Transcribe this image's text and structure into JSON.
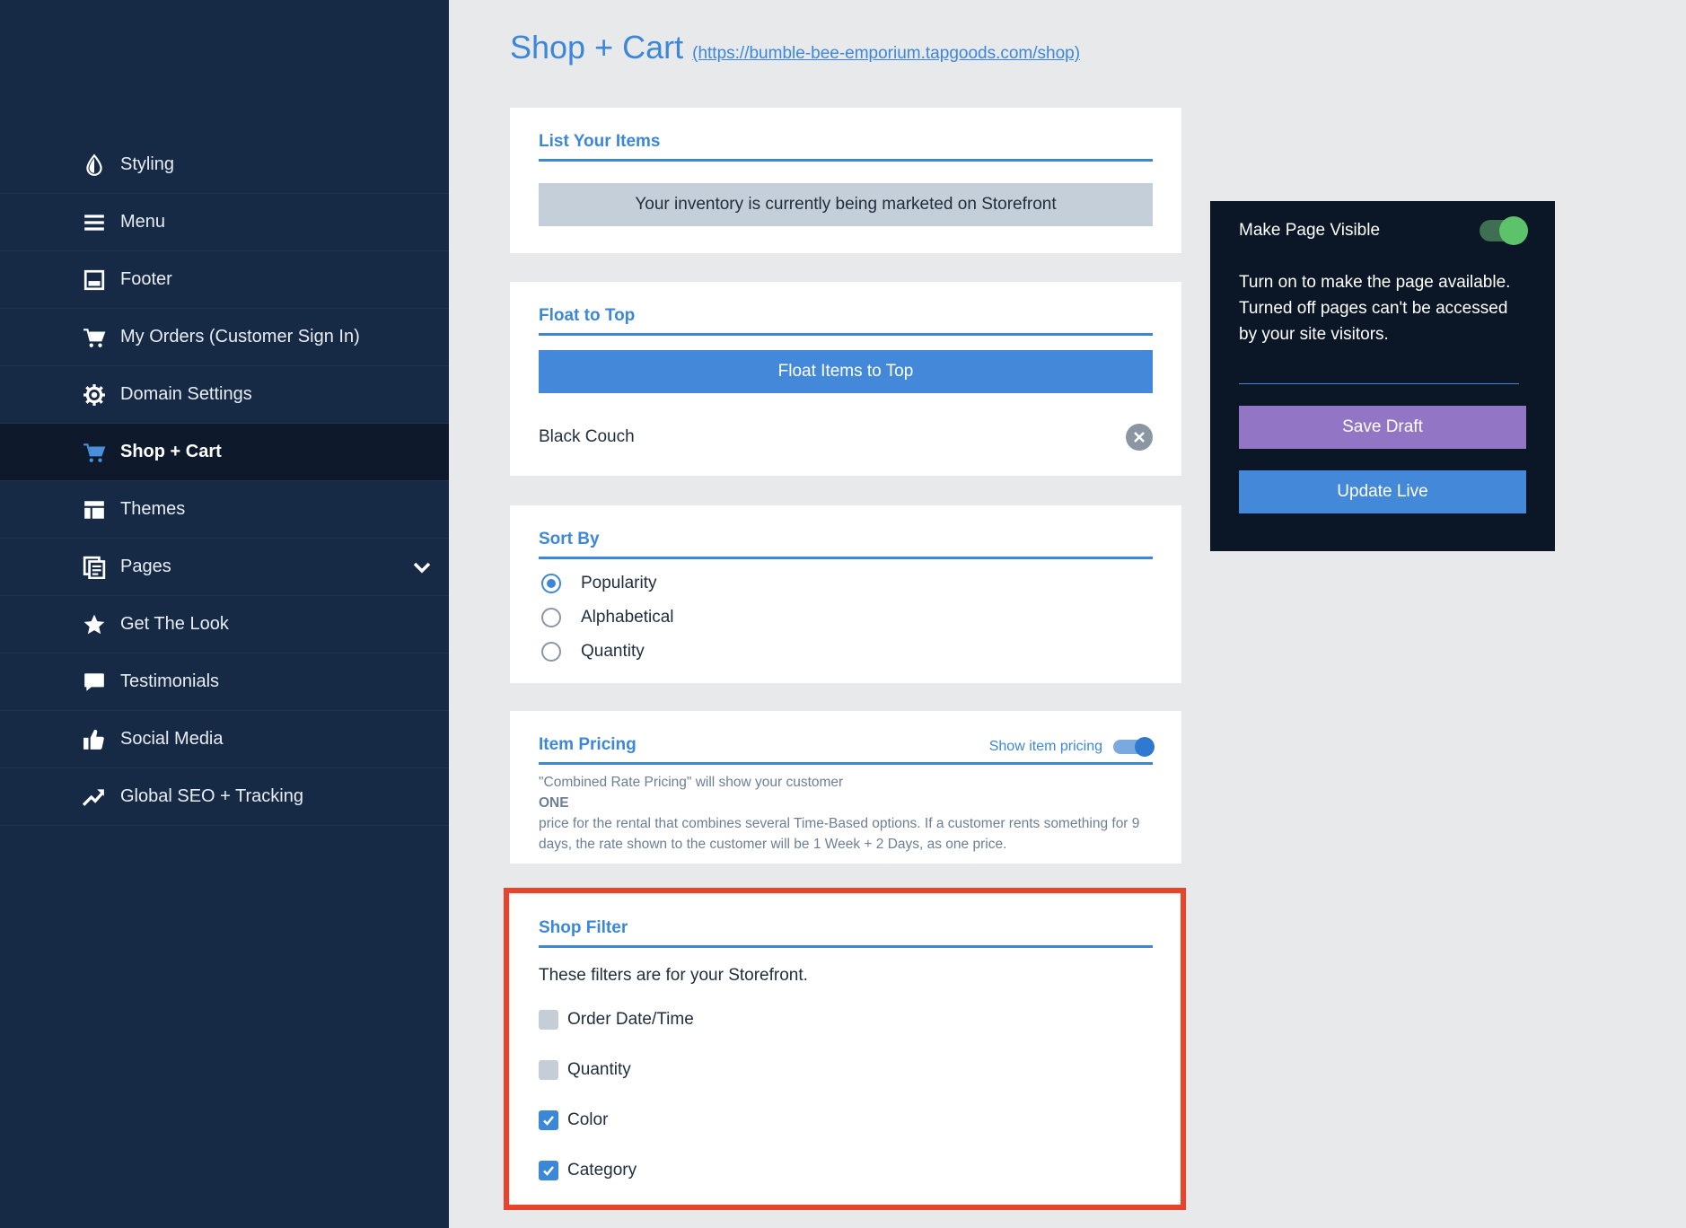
{
  "sidebar": {
    "items": [
      {
        "label": "Styling",
        "icon": "drop-icon"
      },
      {
        "label": "Menu",
        "icon": "hamburger-icon"
      },
      {
        "label": "Footer",
        "icon": "footer-icon"
      },
      {
        "label": "My Orders (Customer Sign In)",
        "icon": "cart-icon"
      },
      {
        "label": "Domain Settings",
        "icon": "gear-icon"
      },
      {
        "label": "Shop + Cart",
        "icon": "cart-icon",
        "active": true
      },
      {
        "label": "Themes",
        "icon": "layout-icon"
      },
      {
        "label": "Pages",
        "icon": "pages-icon",
        "expandable": true
      },
      {
        "label": "Get The Look",
        "icon": "star-icon"
      },
      {
        "label": "Testimonials",
        "icon": "chat-icon"
      },
      {
        "label": "Social Media",
        "icon": "thumbs-up-icon"
      },
      {
        "label": "Global SEO + Tracking",
        "icon": "trend-icon"
      }
    ]
  },
  "header": {
    "title": "Shop + Cart",
    "url": "(https://bumble-bee-emporium.tapgoods.com/shop)"
  },
  "list_items": {
    "title": "List Your Items",
    "status": "Your inventory is currently being marketed on Storefront"
  },
  "float_top": {
    "title": "Float to Top",
    "button": "Float Items to Top",
    "items": [
      "Black Couch"
    ]
  },
  "sort_by": {
    "title": "Sort By",
    "options": [
      "Popularity",
      "Alphabetical",
      "Quantity"
    ],
    "selected": "Popularity"
  },
  "item_pricing": {
    "title": "Item Pricing",
    "toggle_label": "Show item pricing",
    "toggle_on": true,
    "line1": "\"Combined Rate Pricing\" will show your customer",
    "line2": "ONE",
    "line3": "price for the rental that combines several Time-Based options. If a customer rents something for 9 days, the rate shown to the customer will be 1 Week + 2 Days, as one price."
  },
  "shop_filter": {
    "title": "Shop Filter",
    "intro": "These filters are for your Storefront.",
    "filters": [
      {
        "label": "Order Date/Time",
        "checked": false
      },
      {
        "label": "Quantity",
        "checked": false
      },
      {
        "label": "Color",
        "checked": true
      },
      {
        "label": "Category",
        "checked": true
      }
    ]
  },
  "visibility_panel": {
    "title": "Make Page Visible",
    "toggle_on": true,
    "description": "Turn on to make the page available. Turned off pages can't be accessed by your site visitors.",
    "save_draft": "Save Draft",
    "update_live": "Update Live"
  },
  "colors": {
    "sidebar_bg": "#172a45",
    "accent": "#3d87d8",
    "purple": "#9275c4",
    "highlight": "#e8432b",
    "toggle_green": "#5dc36b"
  }
}
